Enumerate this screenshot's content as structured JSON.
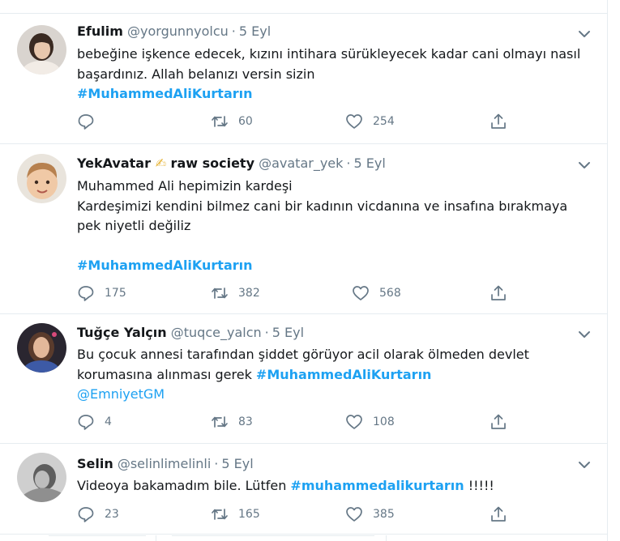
{
  "tweets": [
    {
      "name": "Efulim",
      "handle": "@yorgunnyolcu",
      "date": "5 Eyl",
      "lines": [
        "bebeğine işkence edecek, kızını intihara sürükleyecek kadar cani olmayı nasıl",
        "başardınız. Allah belanızı versin sizin"
      ],
      "hashtag": "#MuhammedAliKurtarın",
      "replies": "",
      "retweets": "60",
      "likes": "254"
    },
    {
      "name": "YekAvatar",
      "name_emoji": "✍",
      "name_suffix": "raw society",
      "handle": "@avatar_yek",
      "date": "5 Eyl",
      "lines": [
        "Muhammed Ali hepimizin kardeşi",
        "Kardeşimizi kendini bilmez cani bir kadının vicdanına ve insafına bırakmaya",
        "pek niyetli değiliz"
      ],
      "hashtag": "#MuhammedAliKurtarın",
      "replies": "175",
      "retweets": "382",
      "likes": "568"
    },
    {
      "name": "Tuğçe Yalçın",
      "handle": "@tuqce_yalcn",
      "date": "5 Eyl",
      "line1": "Bu çocuk annesi tarafından şiddet görüyor acil olarak ölmeden devlet",
      "line2_text": "korumasına alınması gerek ",
      "hashtag": "#MuhammedAliKurtarın",
      "mention": "@EmniyetGM",
      "replies": "4",
      "retweets": "83",
      "likes": "108"
    },
    {
      "name": "Selin",
      "handle": "@selinlimelinli",
      "date": "5 Eyl",
      "text_before": "Videoya bakamadım bile. Lütfen ",
      "hashtag": "#muhammedalikurtarın",
      "text_after": " !!!!!",
      "replies": "23",
      "retweets": "165",
      "likes": "385"
    }
  ],
  "icons": {
    "reply": "reply-icon",
    "retweet": "retweet-icon",
    "like": "heart-icon",
    "share": "share-icon",
    "more": "chevron-down-icon"
  },
  "colors": {
    "link": "#1da1f2",
    "secondary": "#657786",
    "border": "#e6ecf0"
  }
}
